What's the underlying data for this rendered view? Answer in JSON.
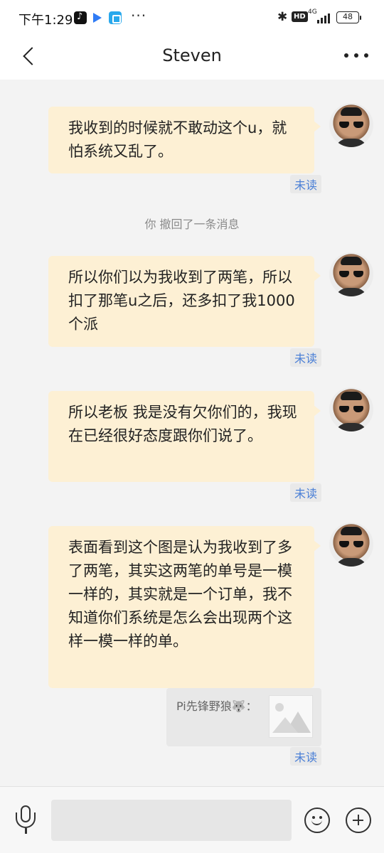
{
  "status_bar": {
    "time": "下午1:29",
    "more": "···",
    "bluetooth": "✱",
    "hd": "HD",
    "network": "4G",
    "battery": "48"
  },
  "header": {
    "title": "Steven"
  },
  "messages": [
    {
      "text": "我收到的时候就不敢动这个u，就怕系统又乱了。",
      "status": "未读"
    },
    {
      "text": "所以你们以为我收到了两笔，所以扣了那笔u之后，还多扣了我1000个派",
      "status": "未读"
    },
    {
      "text": "所以老板 我是没有欠你们的，我现在已经很好态度跟你们说了。",
      "status": "未读"
    },
    {
      "text": "表面看到这个图是认为我收到了多了两笔，其实这两笔的单号是一模一样的，其实就是一个订单，我不知道你们系统是怎么会出现两个这样一模一样的单。",
      "status": "未读"
    }
  ],
  "system_notice": "你 撤回了一条消息",
  "quote": {
    "text": "Pi先锋野狼🐺："
  },
  "colors": {
    "bubble": "#fdf0d4",
    "unread_text": "#4a7fd6",
    "background": "#f3f3f3"
  }
}
